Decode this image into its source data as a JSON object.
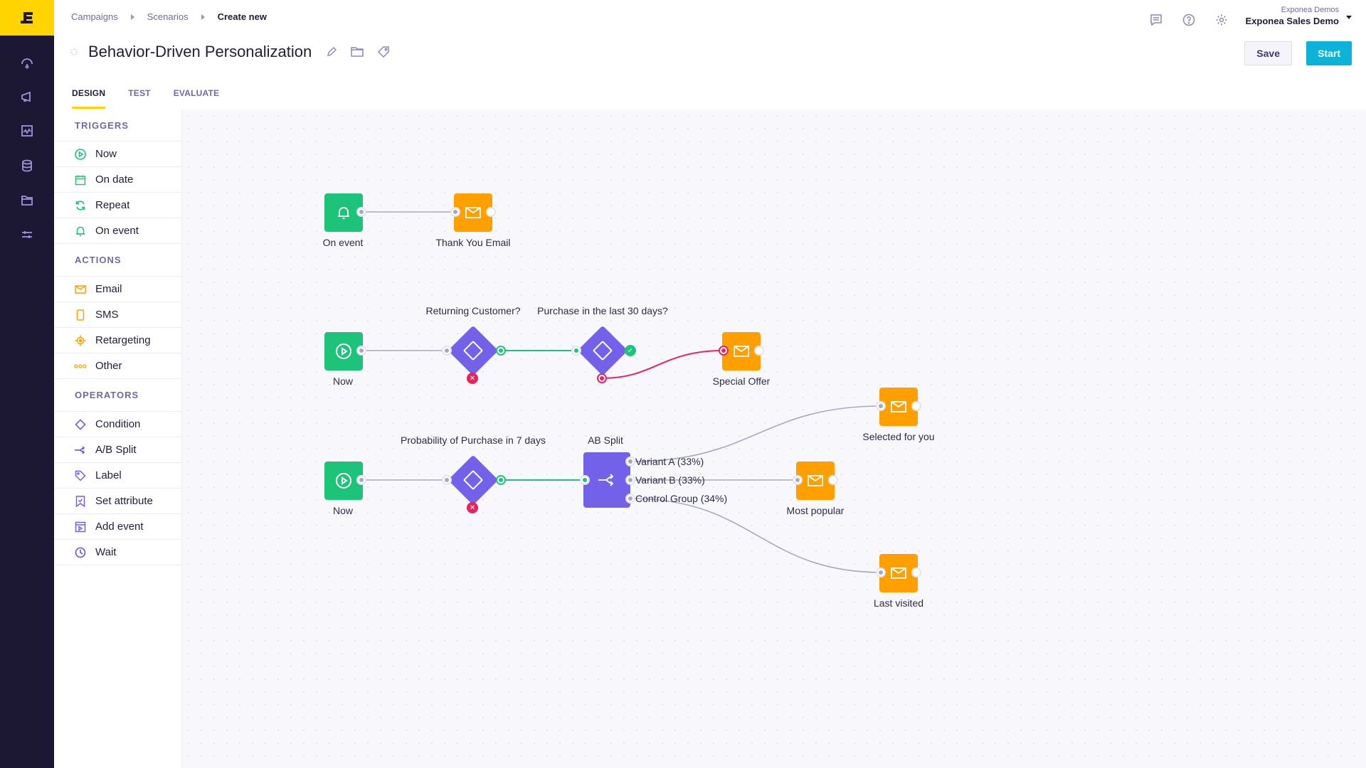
{
  "app": {
    "logo": "exponea-logo"
  },
  "nav": {
    "items": [
      {
        "name": "dashboard",
        "icon": "gauge-icon"
      },
      {
        "name": "campaigns",
        "icon": "megaphone-icon"
      },
      {
        "name": "analyses",
        "icon": "chart-icon"
      },
      {
        "name": "data",
        "icon": "database-icon"
      },
      {
        "name": "assets",
        "icon": "folder-icon"
      },
      {
        "name": "settings",
        "icon": "sliders-icon"
      }
    ]
  },
  "breadcrumb": [
    "Campaigns",
    "Scenarios",
    "Create new"
  ],
  "header": {
    "title": "Behavior-Driven Personalization",
    "account_org": "Exponea Demos",
    "account_project": "Exponea Sales Demo",
    "save_label": "Save",
    "start_label": "Start",
    "icons": [
      "chat-icon",
      "help-icon",
      "gear-icon"
    ]
  },
  "tabs": [
    {
      "label": "DESIGN",
      "active": true
    },
    {
      "label": "TEST",
      "active": false
    },
    {
      "label": "EVALUATE",
      "active": false
    }
  ],
  "palette": {
    "sections": [
      {
        "title": "TRIGGERS",
        "items": [
          "Now",
          "On date",
          "Repeat",
          "On event"
        ]
      },
      {
        "title": "ACTIONS",
        "items": [
          "Email",
          "SMS",
          "Retargeting",
          "Other"
        ]
      },
      {
        "title": "OPERATORS",
        "items": [
          "Condition",
          "A/B Split",
          "Label",
          "Set attribute",
          "Add event",
          "Wait"
        ]
      }
    ]
  },
  "canvas": {
    "nodes": {
      "on_event": "On event",
      "thank_you_email": "Thank You Email",
      "now_1": "Now",
      "returning_customer": "Returning Customer?",
      "purchase_30": "Purchase in the last 30 days?",
      "special_offer": "Special Offer",
      "now_2": "Now",
      "probability_7": "Probability of Purchase in 7 days",
      "ab_split": "AB Split",
      "selected_for_you": "Selected for you",
      "most_popular": "Most popular",
      "last_visited": "Last visited"
    },
    "variants": [
      "Variant A (33%)",
      "Variant B (33%)",
      "Control Group (34%)"
    ],
    "colors": {
      "trigger": "#1ec37a",
      "action": "#ffa000",
      "operator": "#7461ea",
      "yes": "#1ec37a",
      "no": "#e5245e",
      "neutral": "#a6a9c4"
    }
  }
}
